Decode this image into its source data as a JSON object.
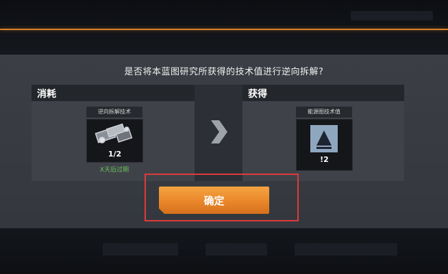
{
  "dialog": {
    "question": "是否将本蓝图研究所获得的技术值进行逆向拆解?",
    "consume": {
      "title": "消耗",
      "item_label": "逆向拆解技术",
      "item_count": "1/2",
      "expire_note": "X天后过期"
    },
    "gain": {
      "title": "获得",
      "item_label": "能源图技术值",
      "item_count": "!2"
    },
    "confirm_label": "确定"
  },
  "colors": {
    "accent_orange": "#e9872b",
    "highlight_red": "#e03a3a",
    "expire_green": "#6fc25a"
  },
  "icons": {
    "arrow": "chevron-right-icon",
    "consume_item": "blueprint-parts-icon",
    "gain_item": "tech-value-triangle-icon"
  }
}
